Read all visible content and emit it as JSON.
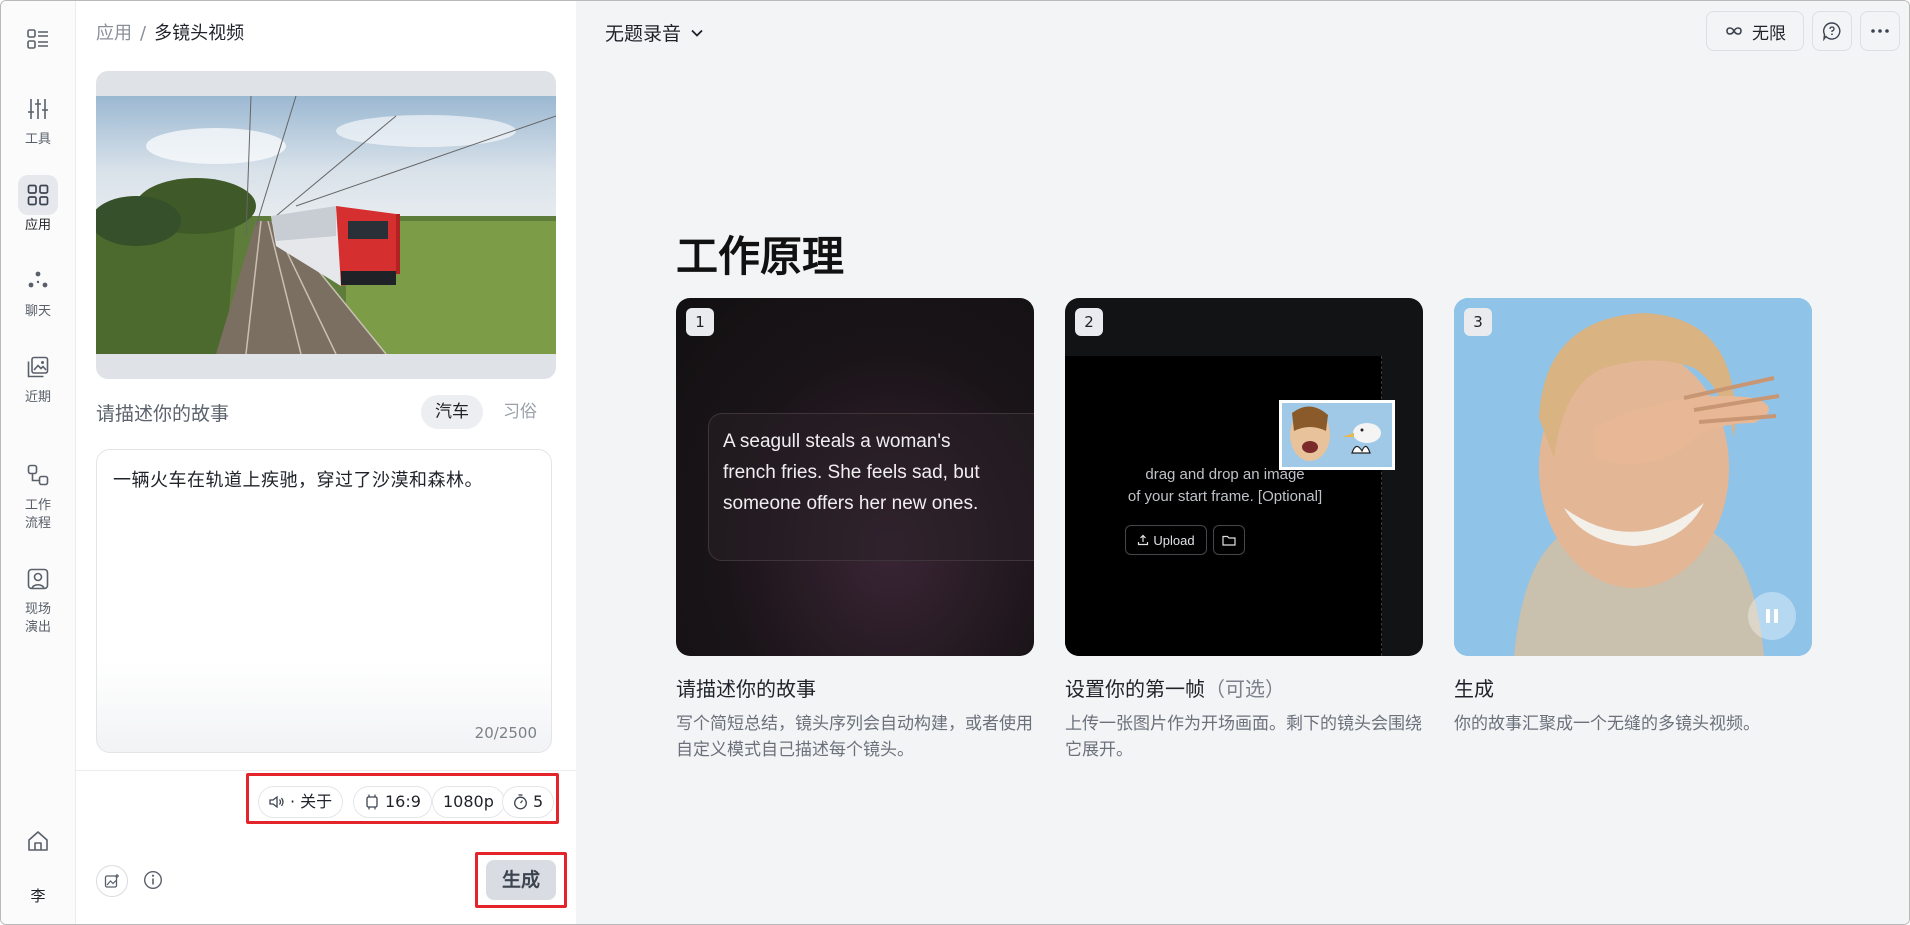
{
  "rail": {
    "items": [
      {
        "label": "工具",
        "icon": "sliders-icon"
      },
      {
        "label": "应用",
        "icon": "grid-icon"
      },
      {
        "label": "聊天",
        "icon": "chat-dots-icon"
      },
      {
        "label": "近期",
        "icon": "recent-image-icon"
      },
      {
        "label": "工作\n流程",
        "icon": "workflow-icon"
      },
      {
        "label": "现场\n演出",
        "icon": "live-icon"
      }
    ],
    "avatar": "李"
  },
  "breadcrumb": {
    "root": "应用",
    "current": "多镜头视频"
  },
  "story": {
    "label": "请描述你的故事",
    "tabs": [
      "汽车",
      "习俗"
    ],
    "text": "一辆火车在轨道上疾驰，穿过了沙漠和森林。",
    "count": "20/2500"
  },
  "settings": {
    "audio": "· 关于",
    "ratio": "16:9",
    "resolution": "1080p",
    "duration": "5"
  },
  "generate_label": "生成",
  "header": {
    "title": "无题录音",
    "unlimited": "无限"
  },
  "how": {
    "title": "工作原理",
    "steps": [
      {
        "num": "1",
        "title": "请描述你的故事",
        "optional": "",
        "desc": "写个简短总结，镜头序列会自动构建，或者使用自定义模式自己描述每个镜头。",
        "demo_text": "A seagull steals a woman's\nfrench fries. She feels sad, but\nsomeone offers her new ones."
      },
      {
        "num": "2",
        "title": "设置你的第一帧",
        "optional": "（可选）",
        "desc": "上传一张图片作为开场画面。剩下的镜头会围绕它展开。",
        "drop_text": "drag and drop an image\nof your start frame. [Optional]",
        "upload": "Upload"
      },
      {
        "num": "3",
        "title": "生成",
        "optional": "",
        "desc": "你的故事汇聚成一个无缝的多镜头视频。"
      }
    ]
  },
  "colors": {
    "highlight": "#e3242b",
    "panel_bg": "#f3f4f6",
    "rail_active": "#e6e8ed"
  }
}
